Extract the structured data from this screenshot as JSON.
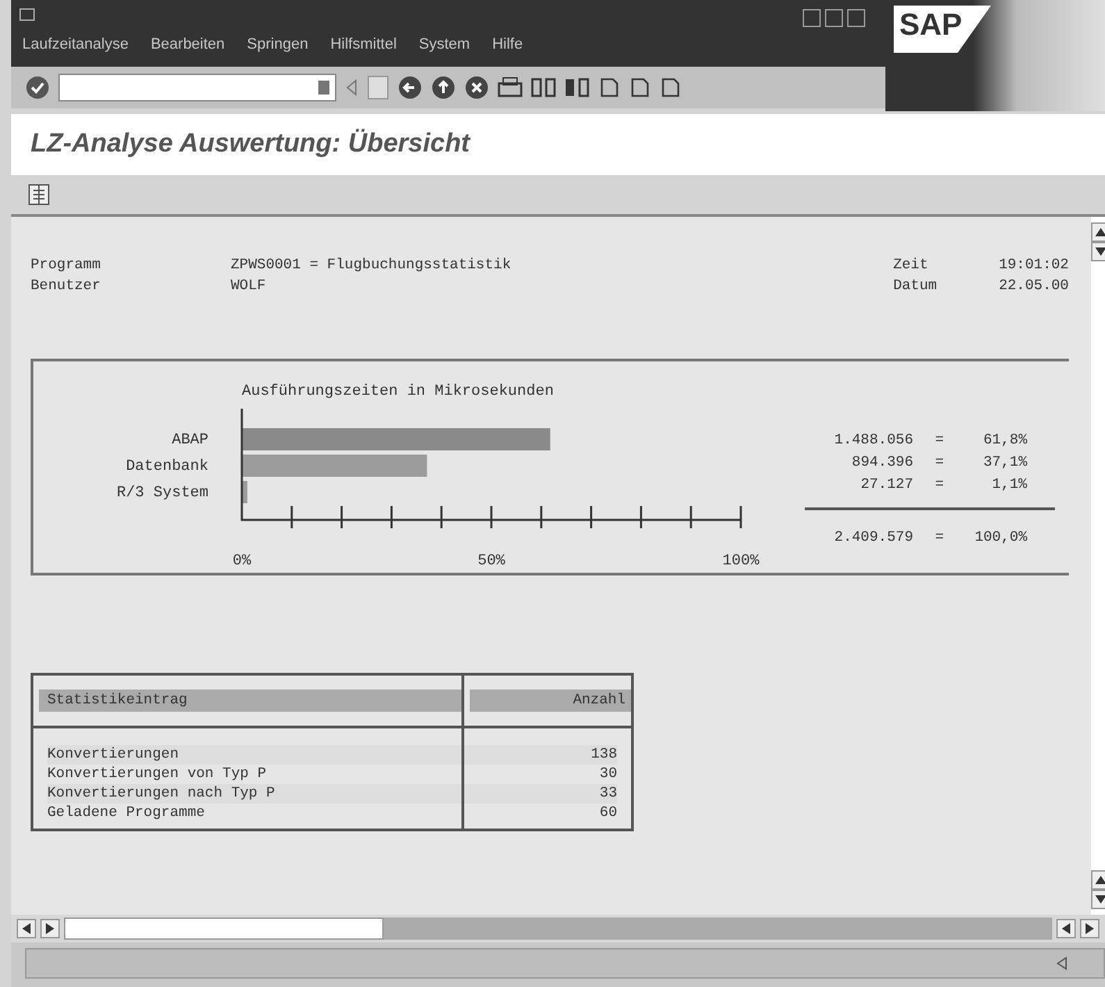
{
  "logo": "SAP",
  "menu": [
    {
      "label": "Laufzeitanalyse"
    },
    {
      "label": "Bearbeiten"
    },
    {
      "label": "Springen"
    },
    {
      "label": "Hilfsmittel"
    },
    {
      "label": "System"
    },
    {
      "label": "Hilfe"
    }
  ],
  "title": "LZ-Analyse Auswertung: Übersicht",
  "header": {
    "left": [
      {
        "label": "Programm",
        "value": "ZPWS0001 = Flugbuchungsstatistik"
      },
      {
        "label": "Benutzer",
        "value": "WOLF"
      }
    ],
    "right": [
      {
        "label": "Zeit",
        "value": "19:01:02"
      },
      {
        "label": "Datum",
        "value": "22.05.00"
      }
    ]
  },
  "runtime": {
    "chart_data": {
      "type": "bar",
      "orientation": "horizontal",
      "title": "Ausführungszeiten in Mikrosekunden",
      "categories": [
        "ABAP",
        "Datenbank",
        "R/3 System"
      ],
      "values": [
        61.8,
        37.1,
        1.1
      ],
      "xlim": [
        0,
        100
      ],
      "xticks": [
        {
          "value": 0,
          "label": "0%"
        },
        {
          "value": 50,
          "label": "50%"
        },
        {
          "value": 100,
          "label": "100%"
        }
      ]
    },
    "figures": [
      {
        "amount": "1.488.056",
        "sign": "=",
        "percent": "61,8%"
      },
      {
        "amount": "894.396",
        "sign": "=",
        "percent": "37,1%"
      },
      {
        "amount": "27.127",
        "sign": "=",
        "percent": "1,1%"
      }
    ],
    "total": {
      "amount": "2.409.579",
      "sign": "=",
      "percent": "100,0%"
    }
  },
  "statistics": {
    "columns": [
      "Statistikeintrag",
      "Anzahl"
    ],
    "rows": [
      {
        "entry": "Konvertierungen",
        "count": "138"
      },
      {
        "entry": "Konvertierungen von Typ P",
        "count": "30"
      },
      {
        "entry": "Konvertierungen nach Typ P",
        "count": "33"
      },
      {
        "entry": "Geladene Programme",
        "count": "60"
      }
    ]
  }
}
